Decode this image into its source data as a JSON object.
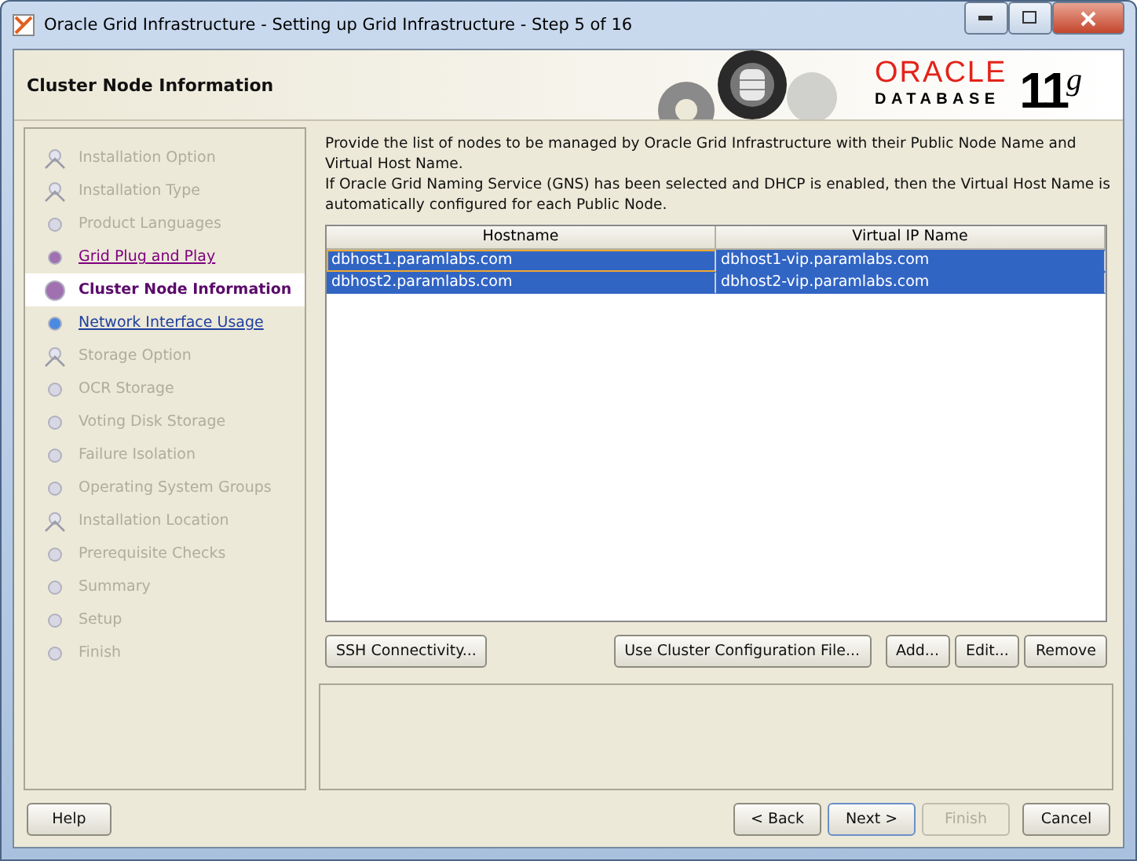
{
  "window": {
    "title": "Oracle Grid Infrastructure - Setting up Grid Infrastructure - Step 5 of 16"
  },
  "header": {
    "title": "Cluster Node Information",
    "logo": {
      "brand": "ORACLE",
      "product": "DATABASE",
      "version": "11$^{g}$"
    }
  },
  "steps": [
    {
      "label": "Installation Option",
      "kind": "fork",
      "selected": false,
      "visited": false,
      "disabled": true
    },
    {
      "label": "Installation Type",
      "kind": "fork",
      "selected": false,
      "visited": false,
      "disabled": true
    },
    {
      "label": "Product Languages",
      "kind": "dot",
      "selected": false,
      "visited": false,
      "disabled": true
    },
    {
      "label": "Grid Plug and Play",
      "kind": "dot",
      "selected": false,
      "visited": true,
      "disabled": false
    },
    {
      "label": "Cluster Node Information",
      "kind": "dot",
      "selected": true,
      "visited": false,
      "disabled": false
    },
    {
      "label": "Network Interface Usage",
      "kind": "dot",
      "selected": false,
      "visited": false,
      "disabled": false
    },
    {
      "label": "Storage Option",
      "kind": "fork",
      "selected": false,
      "visited": false,
      "disabled": true
    },
    {
      "label": "OCR Storage",
      "kind": "dot",
      "selected": false,
      "visited": false,
      "disabled": true
    },
    {
      "label": "Voting Disk Storage",
      "kind": "dot",
      "selected": false,
      "visited": false,
      "disabled": true
    },
    {
      "label": "Failure Isolation",
      "kind": "dot",
      "selected": false,
      "visited": false,
      "disabled": true
    },
    {
      "label": "Operating System Groups",
      "kind": "dot",
      "selected": false,
      "visited": false,
      "disabled": true
    },
    {
      "label": "Installation Location",
      "kind": "fork",
      "selected": false,
      "visited": false,
      "disabled": true
    },
    {
      "label": "Prerequisite Checks",
      "kind": "dot",
      "selected": false,
      "visited": false,
      "disabled": true
    },
    {
      "label": "Summary",
      "kind": "dot",
      "selected": false,
      "visited": false,
      "disabled": true
    },
    {
      "label": "Setup",
      "kind": "dot",
      "selected": false,
      "visited": false,
      "disabled": true
    },
    {
      "label": "Finish",
      "kind": "dot",
      "selected": false,
      "visited": false,
      "disabled": true
    }
  ],
  "instructions": [
    "Provide the list of nodes to be managed by Oracle Grid Infrastructure with their Public Node Name and Virtual Host Name.",
    "If Oracle Grid Naming Service (GNS) has been selected and DHCP is enabled, then the Virtual Host Name is automatically configured for each Public Node."
  ],
  "table": {
    "columns": [
      "Hostname",
      "Virtual IP Name"
    ],
    "rows": [
      {
        "cells": [
          "dbhost1.paramlabs.com",
          "dbhost1-vip.paramlabs.com"
        ],
        "selected": true,
        "focused": true
      },
      {
        "cells": [
          "dbhost2.paramlabs.com",
          "dbhost2-vip.paramlabs.com"
        ],
        "selected": true,
        "focused": false
      }
    ]
  },
  "node_buttons": {
    "left": [
      "SSH Connectivity..."
    ],
    "right": [
      "Use Cluster Configuration File...",
      "Add...",
      "Edit...",
      "Remove"
    ]
  },
  "footer": {
    "help": "Help",
    "buttons": [
      {
        "label": "< Back",
        "disabled": false,
        "default": false
      },
      {
        "label": "Next >",
        "disabled": false,
        "default": true
      },
      {
        "label": "Finish",
        "disabled": true,
        "default": false
      },
      {
        "label": "Cancel",
        "disabled": false,
        "default": false
      }
    ]
  }
}
